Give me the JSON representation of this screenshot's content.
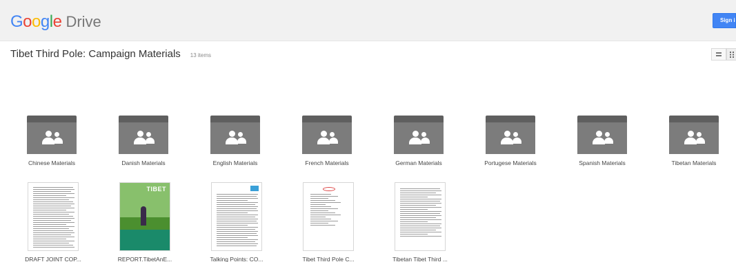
{
  "header": {
    "logo_letters": [
      {
        "char": "G",
        "color": "#4285F4"
      },
      {
        "char": "o",
        "color": "#EA4335"
      },
      {
        "char": "o",
        "color": "#FBBC05"
      },
      {
        "char": "g",
        "color": "#4285F4"
      },
      {
        "char": "l",
        "color": "#34A853"
      },
      {
        "char": "e",
        "color": "#EA4335"
      }
    ],
    "product": "Drive",
    "signin_label": "Sign in"
  },
  "folder_view": {
    "title": "Tibet Third Pole: Campaign Materials",
    "item_count": "13 items",
    "view_buttons": {
      "list_icon": "list-view-icon",
      "grid_icon": "grid-view-icon"
    }
  },
  "folders": [
    {
      "label": "Chinese Materials"
    },
    {
      "label": "Danish Materials"
    },
    {
      "label": "English Materials"
    },
    {
      "label": "French Materials"
    },
    {
      "label": "German Materials"
    },
    {
      "label": "Portugese Materials"
    },
    {
      "label": "Spanish Materials"
    },
    {
      "label": "Tibetan Materials"
    }
  ],
  "files": [
    {
      "label": "DRAFT JOINT COP..."
    },
    {
      "label": "REPORT.TibetAnE...",
      "cover_title": "TIBET"
    },
    {
      "label": "Talking Points: CO..."
    },
    {
      "label": "Tibet Third Pole C..."
    },
    {
      "label": "Tibetan Tibet Third ..."
    }
  ],
  "colors": {
    "folder_body": "#7c7c7c",
    "folder_tab": "#5f5f5f",
    "signin_blue": "#4285f4",
    "header_bg": "#f1f1f1"
  }
}
